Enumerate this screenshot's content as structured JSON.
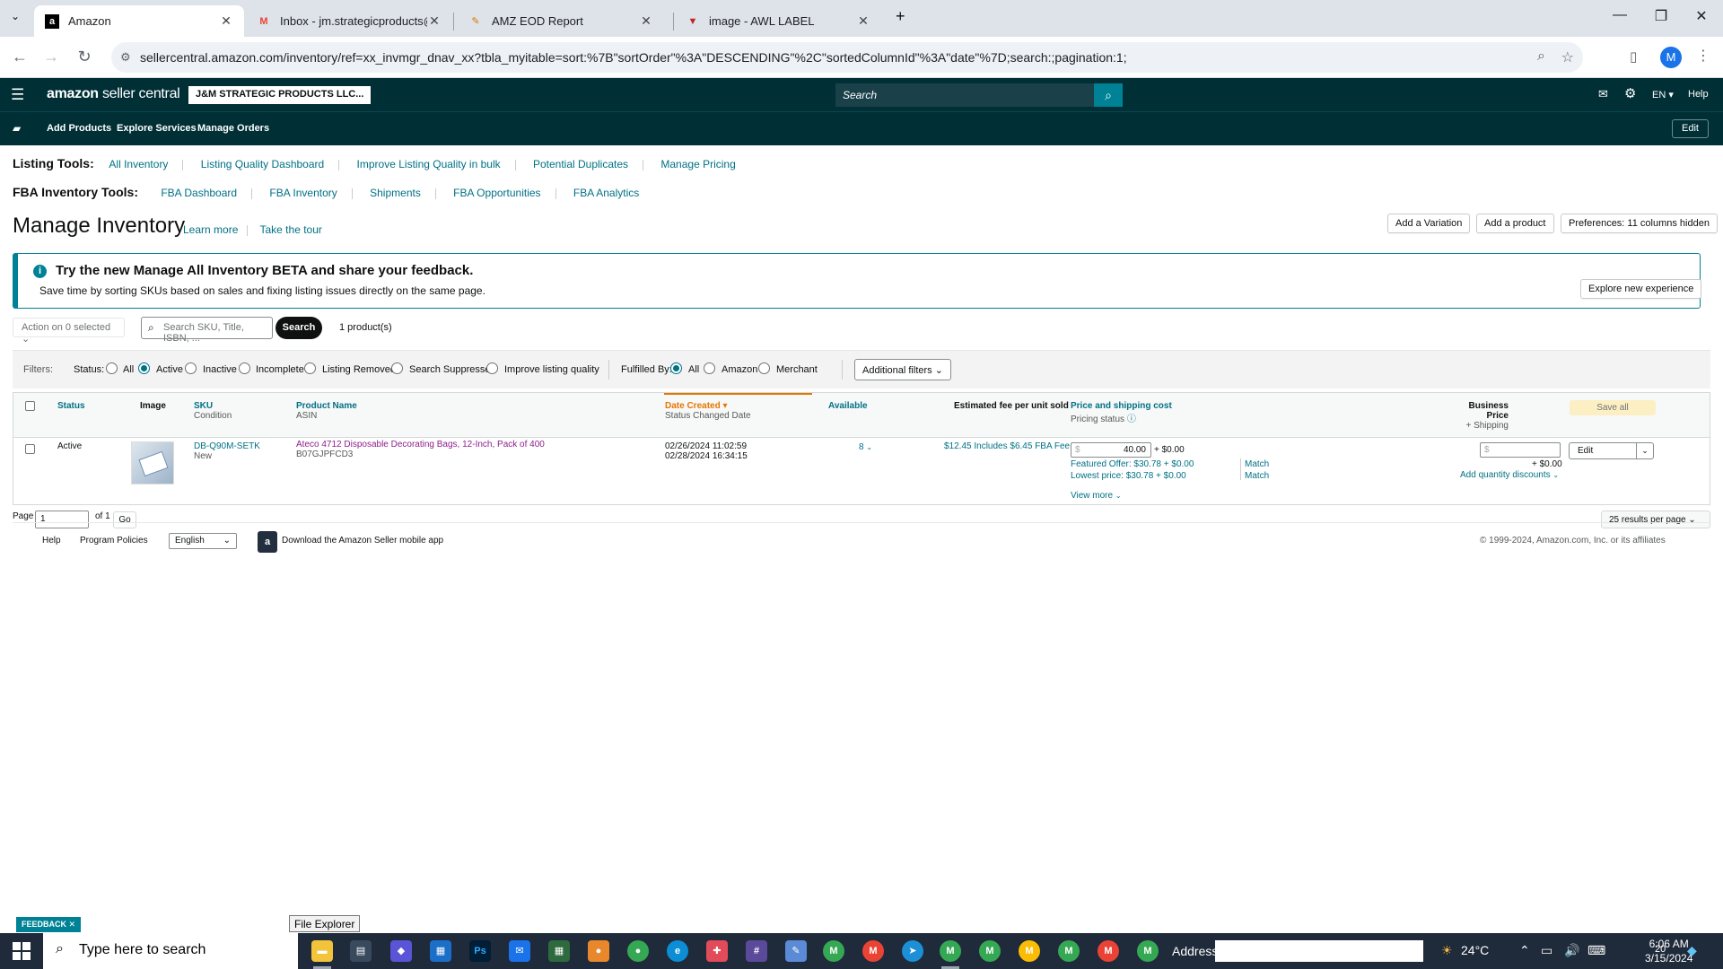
{
  "browser": {
    "tabs": [
      {
        "title": "Amazon",
        "favicon": "a"
      },
      {
        "title": "Inbox - jm.strategicproducts@g",
        "favicon": "M"
      },
      {
        "title": "AMZ EOD Report",
        "favicon": "✎"
      },
      {
        "title": "image - AWL LABEL",
        "favicon": "▼"
      }
    ],
    "url": "sellercentral.amazon.com/inventory/ref=xx_invmgr_dnav_xx?tbla_myitable=sort:%7B\"sortOrder\"%3A\"DESCENDING\"%2C\"sortedColumnId\"%3A\"date\"%7D;search:;pagination:1;",
    "profile_initial": "M"
  },
  "header": {
    "logo": "amazon",
    "logo_suffix": "seller central",
    "store_name": "J&M STRATEGIC PRODUCTS LLC...",
    "search_placeholder": "Search",
    "language": "EN",
    "help": "Help"
  },
  "subnav": {
    "items": [
      "Add Products",
      "Explore Services",
      "Manage Orders"
    ],
    "edit": "Edit"
  },
  "listing_tools": {
    "label": "Listing Tools:",
    "links": [
      "All Inventory",
      "Listing Quality Dashboard",
      "Improve Listing Quality in bulk",
      "Potential Duplicates",
      "Manage Pricing"
    ]
  },
  "fba_tools": {
    "label": "FBA Inventory Tools:",
    "links": [
      "FBA Dashboard",
      "FBA Inventory",
      "Shipments",
      "FBA Opportunities",
      "FBA Analytics"
    ]
  },
  "page": {
    "title": "Manage Inventory",
    "learn_more": "Learn more",
    "take_tour": "Take the tour",
    "add_variation": "Add a Variation",
    "add_product": "Add a product",
    "preferences": "Preferences: 11 columns hidden"
  },
  "banner": {
    "title": "Try the new Manage All Inventory BETA and share your feedback.",
    "subtitle": "Save time by sorting SKUs based on sales and fixing listing issues directly on the same page.",
    "button": "Explore new experience"
  },
  "toolbar": {
    "action": "Action on 0 selected",
    "search_placeholder": "Search SKU, Title, ISBN, ...",
    "search_button": "Search",
    "count": "1 product(s)"
  },
  "filters": {
    "label": "Filters:",
    "status_label": "Status:",
    "status_options": [
      "All",
      "Active",
      "Inactive",
      "Incomplete",
      "Listing Removed",
      "Search Suppressed",
      "Improve listing quality"
    ],
    "status_selected": "Active",
    "fulfilled_label": "Fulfilled By:",
    "fulfilled_options": [
      "All",
      "Amazon",
      "Merchant"
    ],
    "fulfilled_selected": "All",
    "additional": "Additional filters"
  },
  "table": {
    "headers": {
      "status": "Status",
      "image": "Image",
      "sku": "SKU",
      "sku_sub": "Condition",
      "product": "Product Name",
      "product_sub": "ASIN",
      "date": "Date Created",
      "date_sub": "Status Changed Date",
      "available": "Available",
      "fee": "Estimated fee per unit sold",
      "price": "Price and shipping cost",
      "price_sub": "Pricing status",
      "business": "Business Price",
      "business_sub": "+ Shipping",
      "save_all": "Save all"
    },
    "row": {
      "status": "Active",
      "sku": "DB-Q90M-SETK",
      "condition": "New",
      "product_name": "Ateco 4712 Disposable Decorating Bags, 12-Inch, Pack of 400",
      "asin": "B07GJPFCD3",
      "date_created": "02/26/2024 11:02:59",
      "status_changed": "02/28/2024 16:34:15",
      "available": "8",
      "fee": "$12.45 Includes $6.45 FBA Fee",
      "price_currency": "$",
      "price": "40.00",
      "shipping": "+ $0.00",
      "featured_offer": "Featured Offer: $30.78 + $0.00",
      "lowest_price": "Lowest price: $30.78 + $0.00",
      "match": "Match",
      "view_more": "View more",
      "business_shipping": "+ $0.00",
      "quantity_discounts": "Add quantity discounts",
      "edit": "Edit"
    }
  },
  "pagination": {
    "page_label": "Page",
    "page_value": "1",
    "of": "of 1",
    "go": "Go",
    "per_page": "25 results per page"
  },
  "footer": {
    "help": "Help",
    "policies": "Program Policies",
    "language": "English",
    "app": "Download the Amazon Seller mobile app",
    "copyright": "© 1999-2024, Amazon.com, Inc. or its affiliates"
  },
  "feedback": "FEEDBACK",
  "tooltip": "File Explorer",
  "taskbar": {
    "search_placeholder": "Type here to search",
    "address_label": "Address",
    "temperature": "24°C",
    "time": "6:06 AM",
    "date": "3/15/2024",
    "notifications": "20"
  }
}
